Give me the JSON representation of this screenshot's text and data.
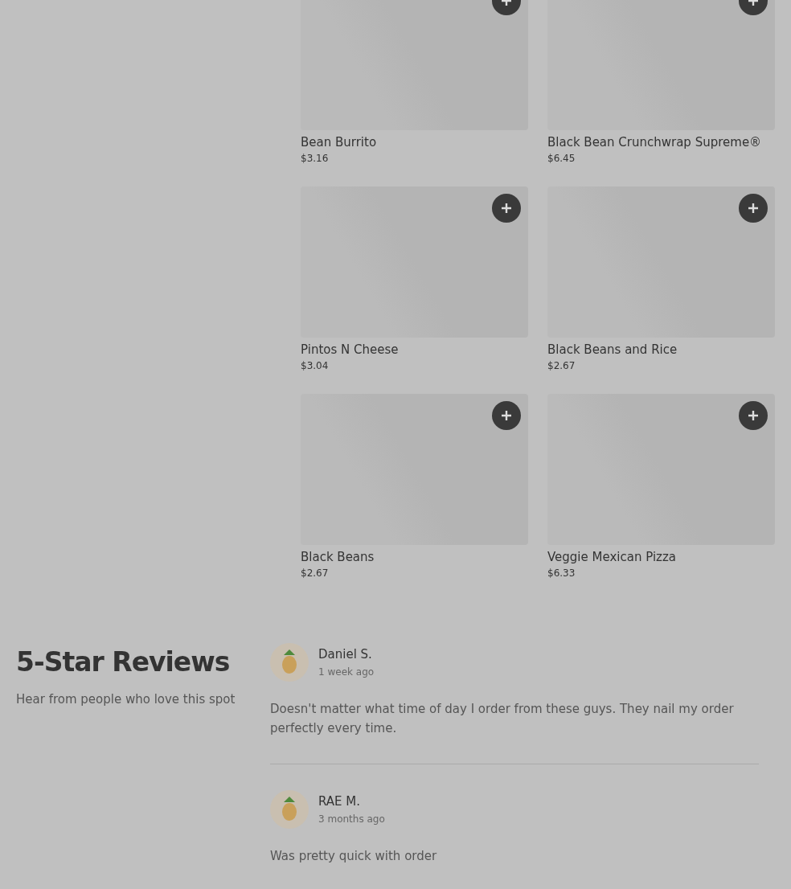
{
  "menu_items": [
    {
      "name": "Bean Burrito",
      "price": "$3.16"
    },
    {
      "name": "Black Bean Crunchwrap Supreme®",
      "price": "$6.45"
    },
    {
      "name": "Pintos N Cheese",
      "price": "$3.04"
    },
    {
      "name": "Black Beans and Rice",
      "price": "$2.67"
    },
    {
      "name": "Black Beans",
      "price": "$2.67"
    },
    {
      "name": "Veggie Mexican Pizza",
      "price": "$6.33"
    }
  ],
  "reviews_section": {
    "title": "5-Star Reviews",
    "subtitle": "Hear from people who love this spot",
    "reviews": [
      {
        "author": "Daniel S.",
        "time": "1 week ago",
        "text": "Doesn't matter what time of day I order from these guys. They nail my order perfectly every time."
      },
      {
        "author": "RAE M.",
        "time": "3 months ago",
        "text": "Was pretty quick with order"
      }
    ]
  }
}
